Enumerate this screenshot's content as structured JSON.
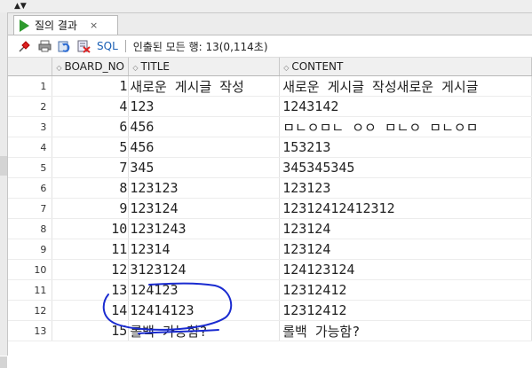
{
  "tab": {
    "label": "질의 결과",
    "close": "×"
  },
  "toolbar": {
    "sql_label": "SQL",
    "status": "인출된 모든 행: 13(0,114초)"
  },
  "table": {
    "headers": [
      "BOARD_NO",
      "TITLE",
      "CONTENT"
    ],
    "rows": [
      {
        "rn": "1",
        "no": "1",
        "title": "새로운 게시글 작성",
        "content": "새로운 게시글 작성새로운 게시글"
      },
      {
        "rn": "2",
        "no": "4",
        "title": "123",
        "content": "1243142"
      },
      {
        "rn": "3",
        "no": "6",
        "title": "456",
        "content": "ㅁㄴㅇㅁㄴ ㅇㅇ ㅁㄴㅇ ㅁㄴㅇㅁ"
      },
      {
        "rn": "4",
        "no": "5",
        "title": "456",
        "content": "153213"
      },
      {
        "rn": "5",
        "no": "7",
        "title": "345",
        "content": "345345345"
      },
      {
        "rn": "6",
        "no": "8",
        "title": "123123",
        "content": "123123"
      },
      {
        "rn": "7",
        "no": "9",
        "title": "123124",
        "content": "12312412412312"
      },
      {
        "rn": "8",
        "no": "10",
        "title": "1231243",
        "content": "123124"
      },
      {
        "rn": "9",
        "no": "11",
        "title": "12314",
        "content": "123124"
      },
      {
        "rn": "10",
        "no": "12",
        "title": "3123124",
        "content": "124123124"
      },
      {
        "rn": "11",
        "no": "13",
        "title": "124123",
        "content": "12312412"
      },
      {
        "rn": "12",
        "no": "14",
        "title": "12414123",
        "content": "12312412"
      },
      {
        "rn": "13",
        "no": "15",
        "title": "롤백 가능함?",
        "content": "롤백 가능함?"
      }
    ]
  },
  "colors": {
    "annotation": "#1a2bd0",
    "run_icon": "#2e9a2e",
    "sql_text": "#1a5fb4"
  }
}
